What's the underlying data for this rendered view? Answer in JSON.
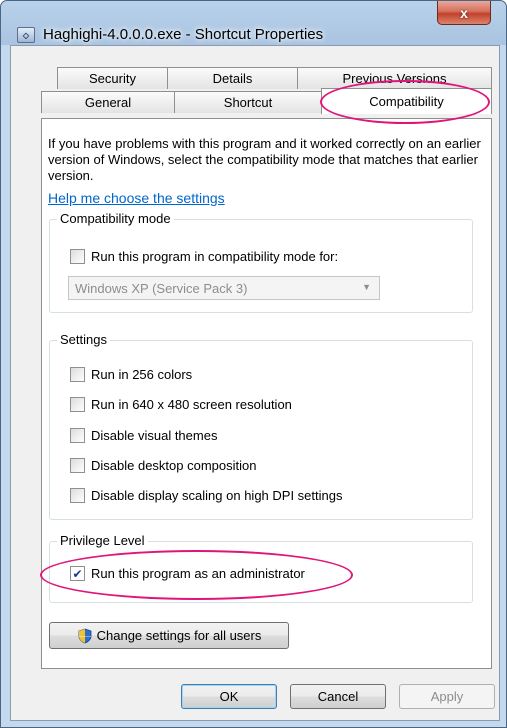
{
  "window": {
    "title": "Haghighi-4.0.0.0.exe - Shortcut Properties",
    "close_label": "x"
  },
  "tabs": {
    "row1": [
      "Security",
      "Details",
      "Previous Versions"
    ],
    "row2": [
      "General",
      "Shortcut",
      "Compatibility"
    ],
    "active": "Compatibility"
  },
  "intro_text": "If you have problems with this program and it worked correctly on an earlier version of Windows, select the compatibility mode that matches that earlier version.",
  "help_link": "Help me choose the settings",
  "compat_mode": {
    "label": "Compatibility mode",
    "checkbox_label": "Run this program in compatibility mode for:",
    "checked": false,
    "select_value": "Windows XP (Service Pack 3)"
  },
  "settings": {
    "label": "Settings",
    "items": [
      {
        "label": "Run in 256 colors",
        "checked": false
      },
      {
        "label": "Run in 640 x 480 screen resolution",
        "checked": false
      },
      {
        "label": "Disable visual themes",
        "checked": false
      },
      {
        "label": "Disable desktop composition",
        "checked": false
      },
      {
        "label": "Disable display scaling on high DPI settings",
        "checked": false
      }
    ]
  },
  "privilege": {
    "label": "Privilege Level",
    "checkbox_label": "Run this program as an administrator",
    "checked": true
  },
  "change_all_button": "Change settings for all users",
  "footer": {
    "ok": "OK",
    "cancel": "Cancel",
    "apply": "Apply"
  },
  "colors": {
    "annotation": "#e0157a",
    "link": "#0066cc"
  },
  "icons": [
    "app-icon",
    "shield-icon",
    "check-icon",
    "dropdown-arrow-icon",
    "close-icon"
  ]
}
